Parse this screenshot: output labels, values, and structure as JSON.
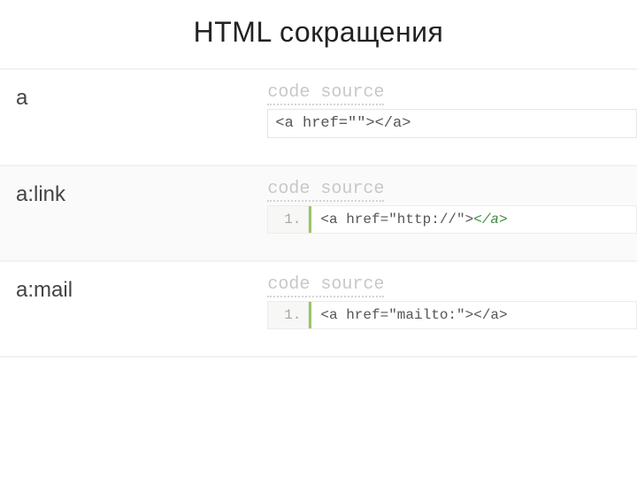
{
  "title": "HTML сокращения",
  "rows": [
    {
      "abbr": "a",
      "tab_label": "code source",
      "style": "plain",
      "code_html": "&lt;a href=\"\"&gt;&lt;/a&gt;"
    },
    {
      "abbr": "a:link",
      "tab_label": "code source",
      "style": "lined",
      "line_number": "1.",
      "code_html": "&lt;a href=\"http://\"&gt;<span class=\"em\">&lt;/a&gt;</span>"
    },
    {
      "abbr": "a:mail",
      "tab_label": "code source",
      "style": "lined",
      "line_number": "1.",
      "code_html": "&lt;a href=\"mailto:\"&gt;&lt;/a&gt;"
    }
  ]
}
